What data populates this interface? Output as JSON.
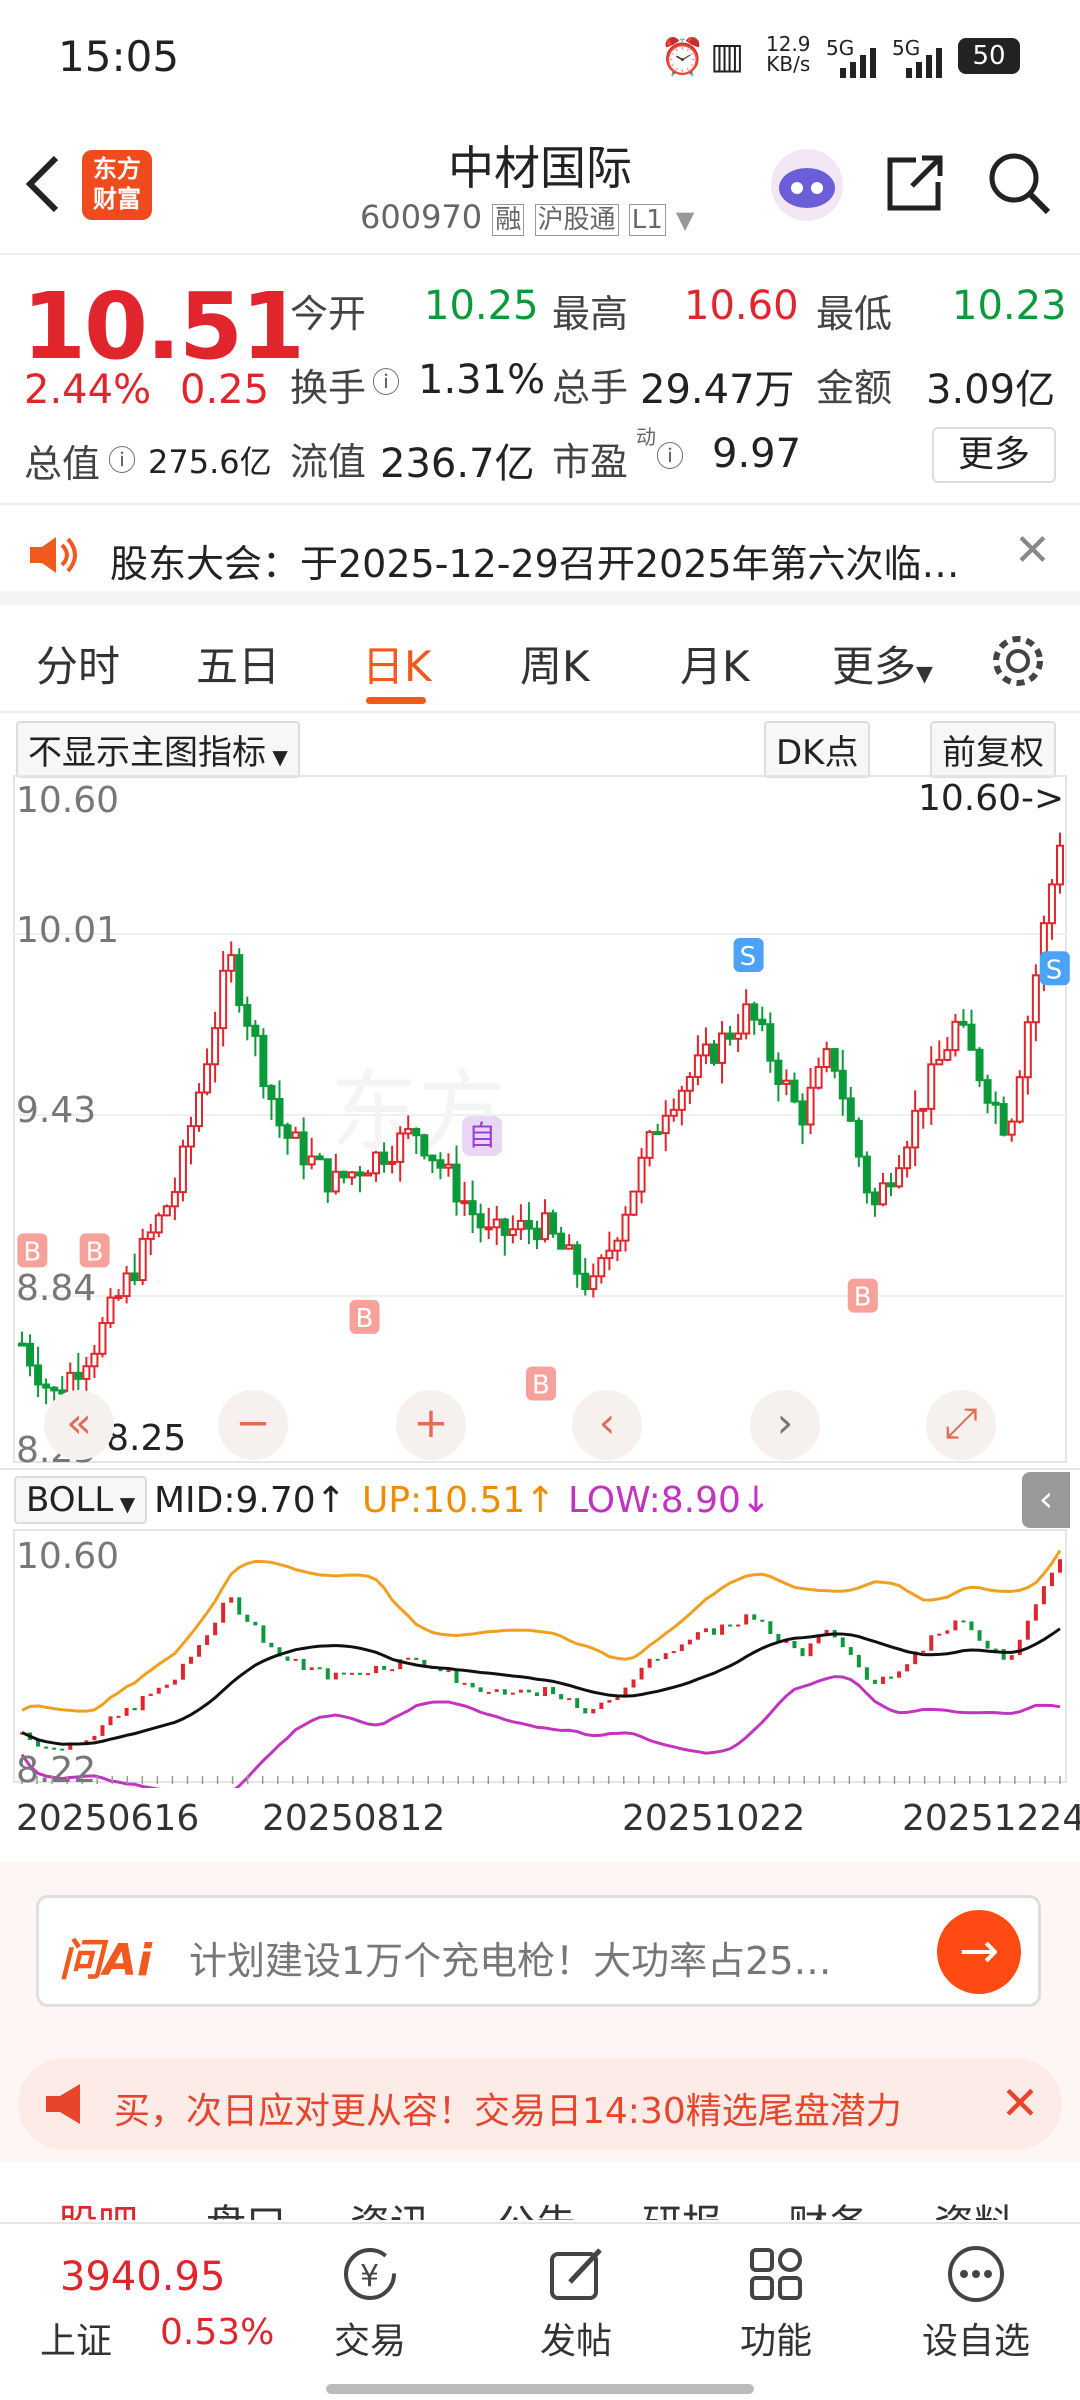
{
  "status_bar": {
    "time": "15:05",
    "net_speed_value": "12.9",
    "net_speed_unit": "KB/s",
    "sim1": "5G",
    "sim2": "5G",
    "battery": "50"
  },
  "header": {
    "logo_text_1": "东方",
    "logo_text_2": "财富",
    "title": "中材国际",
    "code": "600970",
    "badges": [
      "融",
      "沪股通",
      "L1"
    ]
  },
  "quote": {
    "price": "10.51",
    "change_pct": "2.44%",
    "change": "0.25",
    "open_label": "今开",
    "open": "10.25",
    "high_label": "最高",
    "high": "10.60",
    "low_label": "最低",
    "low": "10.23",
    "turnover_label": "换手",
    "turnover": "1.31%",
    "volume_label": "总手",
    "volume": "29.47万",
    "amount_label": "金额",
    "amount": "3.09亿",
    "mktcap_label": "总值",
    "mktcap": "275.6亿",
    "float_label": "流值",
    "float_cap": "236.7亿",
    "pe_label": "市盈",
    "pe_sup": "动",
    "pe": "9.97",
    "more_button": "更多"
  },
  "notice": {
    "text": "股东大会：于2025-12-29召开2025年第六次临…"
  },
  "tabs": [
    "分时",
    "五日",
    "日K",
    "周K",
    "月K",
    "更多"
  ],
  "active_tab": "日K",
  "toolbar": {
    "indicator_select": "不显示主图指标",
    "dk_button": "DK点",
    "adjust_button": "前复权"
  },
  "main_chart": {
    "y_labels": [
      "10.60",
      "10.01",
      "9.43",
      "8.84",
      "8.25"
    ],
    "high_annot": "10.60->",
    "low_annot": "<--8.25",
    "self_marker": "自"
  },
  "boll": {
    "select": "BOLL",
    "mid_label": "MID:9.70",
    "up_label": "UP:10.51",
    "low_label": "LOW:8.90",
    "y_top": "10.60",
    "y_bottom": "8.22",
    "dates": [
      "20250616",
      "20250812",
      "20251022",
      "20251224"
    ]
  },
  "colors": {
    "up": "#e0262c",
    "down": "#0b9a3a",
    "mid": "#111111",
    "upper": "#f0a020",
    "lower": "#c233c2",
    "accent": "#ff5a1f"
  },
  "ai_box": {
    "logo": "问Ai",
    "text": "计划建设1万个充电枪！大功率占25…"
  },
  "promo_banner": {
    "text": "买，次日应对更从容！交易日14:30精选尾盘潜力"
  },
  "sub_tabs": [
    "股吧",
    "盘口",
    "资讯",
    "公告",
    "研报",
    "财务",
    "资料"
  ],
  "bottom_bar": {
    "index_value": "3940.95",
    "index_name": "上证",
    "index_change": "0.53%",
    "items": [
      "交易",
      "发帖",
      "功能",
      "设自选"
    ]
  }
}
